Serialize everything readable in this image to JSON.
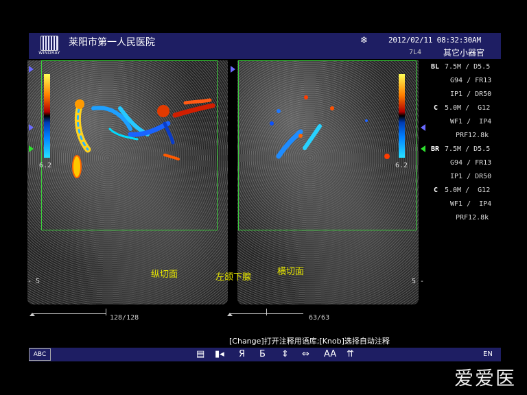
{
  "header": {
    "logo_brand": "WINDRAY",
    "hospital": "莱阳市第一人民医院",
    "freeze_icon": "snowflake-icon",
    "datetime": "2012/02/11  08:32:30AM",
    "probe": "7L4",
    "preset": "其它小器官"
  },
  "left_image": {
    "scale_value": "6.2",
    "depth_label": "5",
    "frame_counter": "128/128",
    "frame_progress": 1.0
  },
  "right_image": {
    "scale_value": "6.2",
    "depth_label": "5",
    "frame_counter": "63/63",
    "frame_progress": 1.0
  },
  "annotations": {
    "longitudinal": "纵切面",
    "organ": "左颌下腺",
    "transverse": "横切面"
  },
  "params": {
    "bl_label": "BL",
    "bl_l1": "7.5M / D5.5",
    "bl_l2": "G94 / FR13",
    "bl_l3": "IP1 / DR50",
    "c1_label": "C",
    "c1_l1": "5.0M /  G12",
    "c1_l2": "WF1 /  IP4",
    "c1_l3": "PRF12.8k",
    "br_label": "BR",
    "br_l1": "7.5M / D5.5",
    "br_l2": "G94 / FR13",
    "br_l3": "IP1 / DR50",
    "c2_label": "C",
    "c2_l1": "5.0M /  G12",
    "c2_l2": "WF1 /  IP4",
    "c2_l3": "PRF12.8k"
  },
  "footer": {
    "hint": "[Change]打开注释用语库;[Knob]选择自动注释",
    "abc_button": "ABC",
    "tools": [
      "▤",
      "▮◂",
      "Я",
      "Ƃ",
      "⇕",
      "⇔",
      "AA",
      "⇈"
    ],
    "language": "EN",
    "watermark": "爱爱医"
  },
  "colors": {
    "header_bg": "#1e1e63",
    "roi_box": "#3ccf3c",
    "annotation": "#e6e600"
  }
}
